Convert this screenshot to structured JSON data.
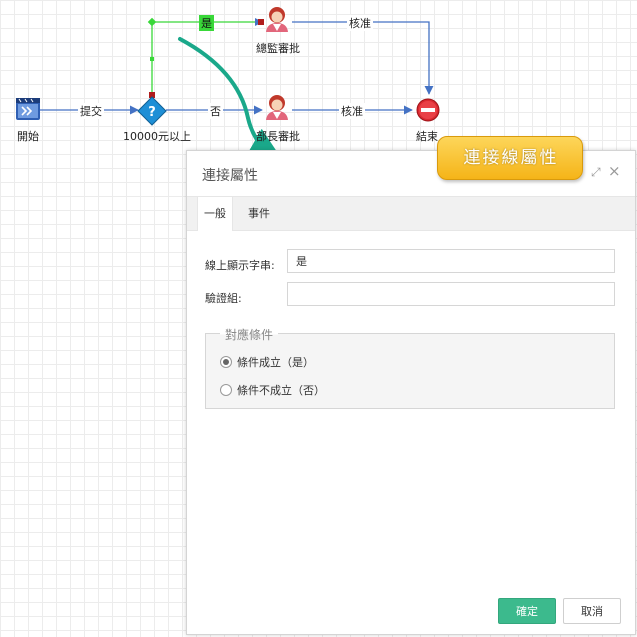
{
  "workflow": {
    "nodes": {
      "start": "開始",
      "condition": "10000元以上",
      "director": "總監審批",
      "manager": "部長審批",
      "end": "結束"
    },
    "edges": {
      "submit": "提交",
      "yes": "是",
      "no": "否",
      "approve_top": "核准",
      "approve_bottom": "核准"
    },
    "colors": {
      "edge": "#4472c4",
      "selected_edge": "#39d839",
      "arrow_annotation": "#1aa88a"
    }
  },
  "callout": {
    "text": "連接線屬性",
    "color": "#f5b418"
  },
  "dialog": {
    "title": "連接屬性",
    "tabs": [
      "一般",
      "事件"
    ],
    "active_tab": "一般",
    "fields": {
      "display_string_label": "線上顯示字串:",
      "display_string_value": "是",
      "validation_group_label": "驗證組:",
      "validation_group_value": ""
    },
    "condition_group": {
      "legend": "對應條件",
      "options": [
        "條件成立（是）",
        "條件不成立（否）"
      ],
      "selected": "條件成立（是）"
    },
    "buttons": {
      "ok": "確定",
      "cancel": "取消"
    },
    "colors": {
      "ok_button": "#3cba8d"
    }
  }
}
